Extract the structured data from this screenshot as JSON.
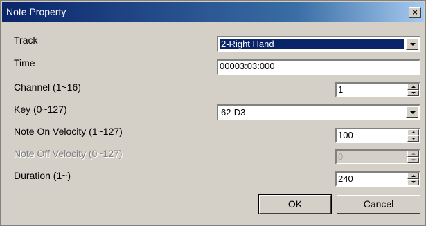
{
  "window": {
    "title": "Note Property",
    "close_glyph": "×"
  },
  "fields": {
    "track": {
      "label": "Track",
      "value": "2-Right Hand"
    },
    "time": {
      "label": "Time",
      "value": "00003:03:000"
    },
    "channel": {
      "label": "Channel (1~16)",
      "value": "1"
    },
    "key": {
      "label": "Key (0~127)",
      "value": "62-D3"
    },
    "note_on_velocity": {
      "label": "Note On Velocity (1~127)",
      "value": "100"
    },
    "note_off_velocity": {
      "label": "Note Off Velocity (0~127)",
      "value": "0",
      "enabled": false
    },
    "duration": {
      "label": "Duration (1~)",
      "value": "240"
    }
  },
  "buttons": {
    "ok": "OK",
    "cancel": "Cancel"
  },
  "colors": {
    "titlebar_start": "#0a246a",
    "titlebar_end": "#a6caf0",
    "dialog_bg": "#d4d0c8",
    "selection": "#0a246a"
  }
}
